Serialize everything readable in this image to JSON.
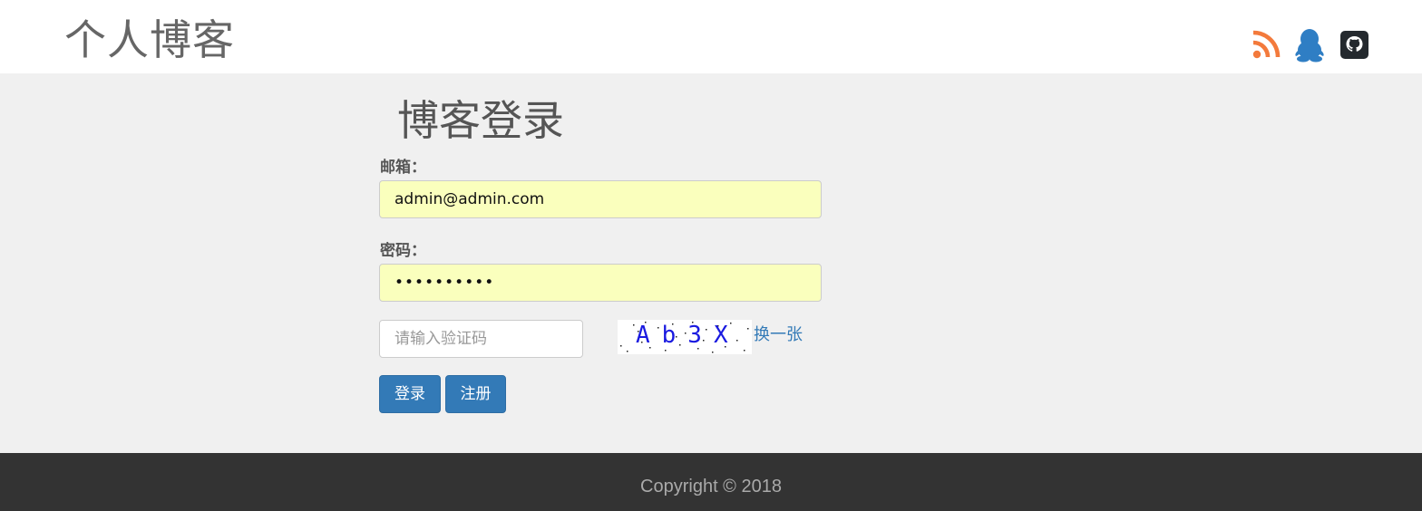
{
  "header": {
    "brand": "个人博客",
    "icons": [
      "rss-icon",
      "qq-icon",
      "github-icon"
    ],
    "rss_color": "#f37a3c",
    "qq_color": "#2f7ec4",
    "github_color": "#24292e"
  },
  "login": {
    "title": "博客登录",
    "email_label": "邮箱：",
    "email_value": "admin@admin.com",
    "password_label": "密码：",
    "password_value": "••••••••••",
    "captcha_placeholder": "请输入验证码",
    "captcha_image_text": "Ab3X",
    "refresh_label": "换一张",
    "login_button": "登录",
    "register_button": "注册"
  },
  "footer": {
    "copyright": "Copyright © 2018"
  },
  "colors": {
    "primary": "#337ab7",
    "autofill": "#faffbd",
    "footer_bg": "#333333",
    "page_bg": "#f0f0f0"
  }
}
